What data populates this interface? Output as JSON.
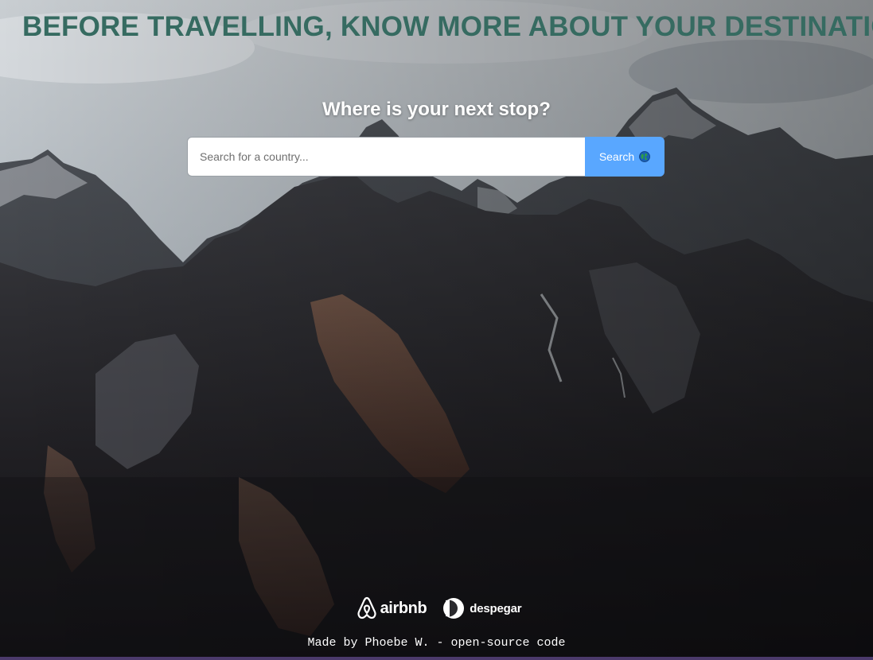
{
  "header": {
    "headline": "BEFORE TRAVELLING, KNOW MORE ABOUT YOUR DESTINATION"
  },
  "search": {
    "question": "Where is your next stop?",
    "placeholder": "Search for a country...",
    "value": "",
    "button_label": "Search",
    "button_icon": "globe-icon"
  },
  "partners": [
    {
      "name": "airbnb",
      "icon": "airbnb-logo-icon"
    },
    {
      "name": "despegar",
      "icon": "despegar-logo-icon"
    }
  ],
  "footer": {
    "text": "Made by Phoebe W. - open-source code"
  },
  "colors": {
    "headline": "#366b61",
    "search_button": "#59a7ff",
    "bottom_line": "#4b3a6b"
  }
}
